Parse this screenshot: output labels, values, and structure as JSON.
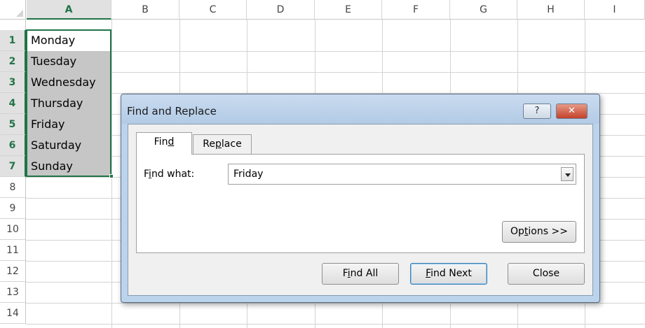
{
  "spreadsheet": {
    "columns": [
      "A",
      "B",
      "C",
      "D",
      "E",
      "F",
      "G",
      "H",
      "I"
    ],
    "selected_column": "A",
    "rows": [
      "1",
      "2",
      "3",
      "4",
      "5",
      "6",
      "7",
      "8",
      "9",
      "10",
      "11",
      "12",
      "13",
      "14"
    ],
    "selected_rows": [
      "1",
      "2",
      "3",
      "4",
      "5",
      "6",
      "7"
    ],
    "column_a_values": [
      "Monday",
      "Tuesday",
      "Wednesday",
      "Thursday",
      "Friday",
      "Saturday",
      "Sunday"
    ],
    "selection_color": "#217346",
    "selection_fill": "#c6c6c6"
  },
  "dialog": {
    "title": "Find and Replace",
    "help_icon": "?",
    "close_icon": "✕",
    "tabs": [
      {
        "label_pre": "Fin",
        "label_key": "d",
        "label_post": ""
      },
      {
        "label_pre": "Re",
        "label_key": "p",
        "label_post": "lace"
      }
    ],
    "find_what": {
      "label_pre": "F",
      "label_key": "i",
      "label_post": "nd what:",
      "value": "Friday"
    },
    "buttons": {
      "options": {
        "pre": "Op",
        "key": "t",
        "post": "ions >>"
      },
      "find_all": {
        "pre": "F",
        "key": "i",
        "post": "nd All"
      },
      "find_next": {
        "pre": "",
        "key": "F",
        "post": "ind Next"
      },
      "close": "Close"
    }
  }
}
